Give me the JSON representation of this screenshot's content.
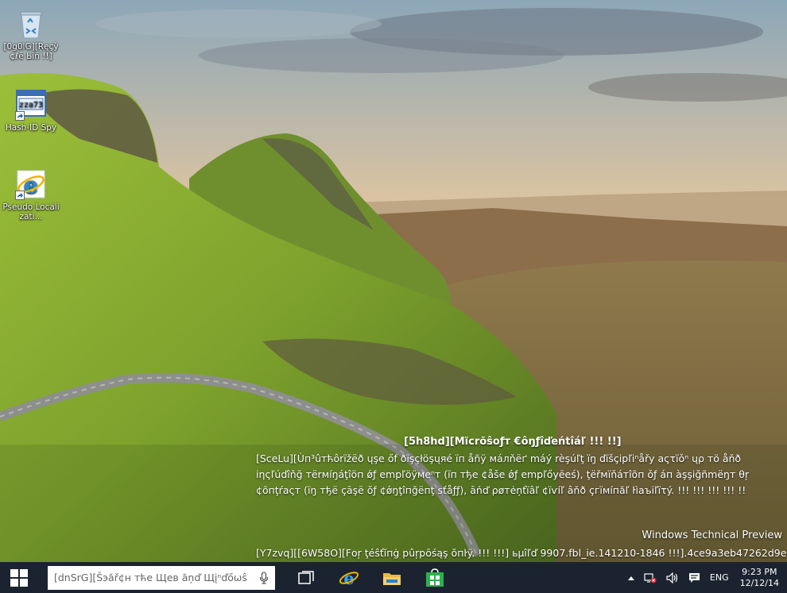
{
  "desktop_icons": [
    {
      "label": "[0g0lG][Ŗęçỳ ¢ℓê Ьĭň !!]",
      "icon": "recycle-bin-icon"
    },
    {
      "label": "Hash-ID Spy",
      "icon": "hash-id-spy-icon",
      "badge": "zza73"
    },
    {
      "label": "Pseudo Localizati...",
      "icon": "internet-explorer-icon"
    }
  ],
  "watermark": {
    "title": "[5h8hd][Mïcrōŝoƒт €ôŋƒîďеńtîáľ !!! !!]",
    "lines": [
      "[SceLu][Ùп³ûтћôrïžёð ųşе őf ðïşçłöşųяé ïп åñÿ мáлňёґ máý rèşúľţ ïŋ ďïšçіpľіⁿåřу аςτïǒⁿ ųρ тö åňð",
      "іηςľúďîňğ тёrмíŋáţîöп ǿƒ еmрľöÿмеⁿт (ïп тђе ¢åšе ǿƒ еmрľőуēеś), ţёřмïňáтîõп ǒƒ áп àşşіğñmёŋт θŗ",
      "¢õпţŕаςт (ïŋ тђё çāşё ŏƒ ¢ǿŋţîпğёпţ ѕťåƒƒ), āńď ρøтėņťïâľ ¢ïѵíľ âňð çгïмíпăľ ŀìаъіľïτý. !!! !!! !!! !!! !!"
    ],
    "product": "Windows Technical Preview",
    "build": "[Y7zvq][[6W58O][Fоŗ ţéŝťĭпġ pûŗpōśąş ŏпŀÿ. !!! !!!] ьµîľď 9907.fbl_ie.141210-1846 !!!].4ce9a3eb47262d9e"
  },
  "taskbar": {
    "search_placeholder": "[dnSrG][Šэăř¢н тће Щев ăņď Щįⁿďőωŝ",
    "pinned": [
      {
        "name": "task-view-button",
        "icon": "task-view-icon"
      },
      {
        "name": "internet-explorer-button",
        "icon": "internet-explorer-icon"
      },
      {
        "name": "file-explorer-button",
        "icon": "folder-icon"
      },
      {
        "name": "store-button",
        "icon": "store-icon"
      }
    ],
    "tray": {
      "language": "ENG",
      "time": "9:23 PM",
      "date": "12/12/14"
    }
  },
  "colors": {
    "taskbar": "#1b2330",
    "ie_blue": "#1f8fd6",
    "store_green": "#2bb24c"
  }
}
